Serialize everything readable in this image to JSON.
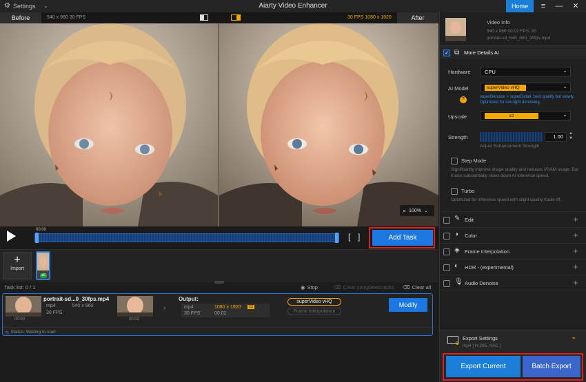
{
  "titlebar": {
    "settings": "Settings",
    "title": "Aiarty Video Enhancer",
    "home": "Home"
  },
  "preview": {
    "before_label": "Before",
    "before_info": "540 x 960   30 FPS",
    "after_info": "30 FPS   1080 x 1920",
    "after_label": "After",
    "zoom": "100%"
  },
  "timeline": {
    "time": "00:00",
    "add_task": "Add Task"
  },
  "media": {
    "import": "Import"
  },
  "tasklist": {
    "header": "Task list:  0 / 1",
    "stop": "Stop",
    "clear_completed": "Clear completed tasks",
    "clear_all": "Clear all",
    "file_name": "portrait-sd...0_30fps.mp4",
    "src_format": "mp4",
    "src_res": "540 x 960",
    "src_fps": "30 FPS",
    "src_time_start": "00:00",
    "src_time_end": "00:02",
    "output_label": "Output:",
    "out_format": "mp4",
    "out_res": "1080 x 1920",
    "out_scale": "x2",
    "out_fps": "30 FPS",
    "out_duration": "00:02",
    "model_tag": "superVideo vHQ",
    "frame_interp_tag": "Frame Interpolation",
    "modify": "Modify",
    "status": "Status: Waiting to start"
  },
  "rpanel": {
    "video_info": "Video Info",
    "vi_line1": "540 x 960   00:02   FPS: 30",
    "vi_line2": "portrait-sd_540_960_30fps.mp4",
    "more_details": "More Details AI",
    "hardware_label": "Hardware",
    "hardware_value": "CPU",
    "aimodel_label": "AI Model",
    "aimodel_value": "superVideo vHQ",
    "aimodel_desc": "superDenoise + superDetail, best quality but slowly.  Optimized for low-light denoising.",
    "upscale_label": "Upscale",
    "upscale_value": "x2",
    "strength_label": "Strength",
    "strength_value": "1.00",
    "strength_hint": "Adjust Enhancement Strength",
    "stepmode_label": "Step Mode",
    "stepmode_desc": "Significantly improve image quality and reduces VRAM usage. But it also substantially slows down AI inference speed.",
    "turbo_label": "Turbo",
    "turbo_desc": "Optimized for inference speed with slight quality trade-off.",
    "sections": [
      "Edit",
      "Color",
      "Frame Interpolation",
      "HDR - (experimental)",
      "Audio Denoise"
    ],
    "export_settings": "Export Settings",
    "export_format": "mp4 [ H.265, AAC ]",
    "export_current": "Export Current",
    "batch_export": "Batch Export"
  },
  "colors": {
    "accent": "#1c78e0",
    "highlight": "#f5a800",
    "annotation": "#e02020"
  }
}
